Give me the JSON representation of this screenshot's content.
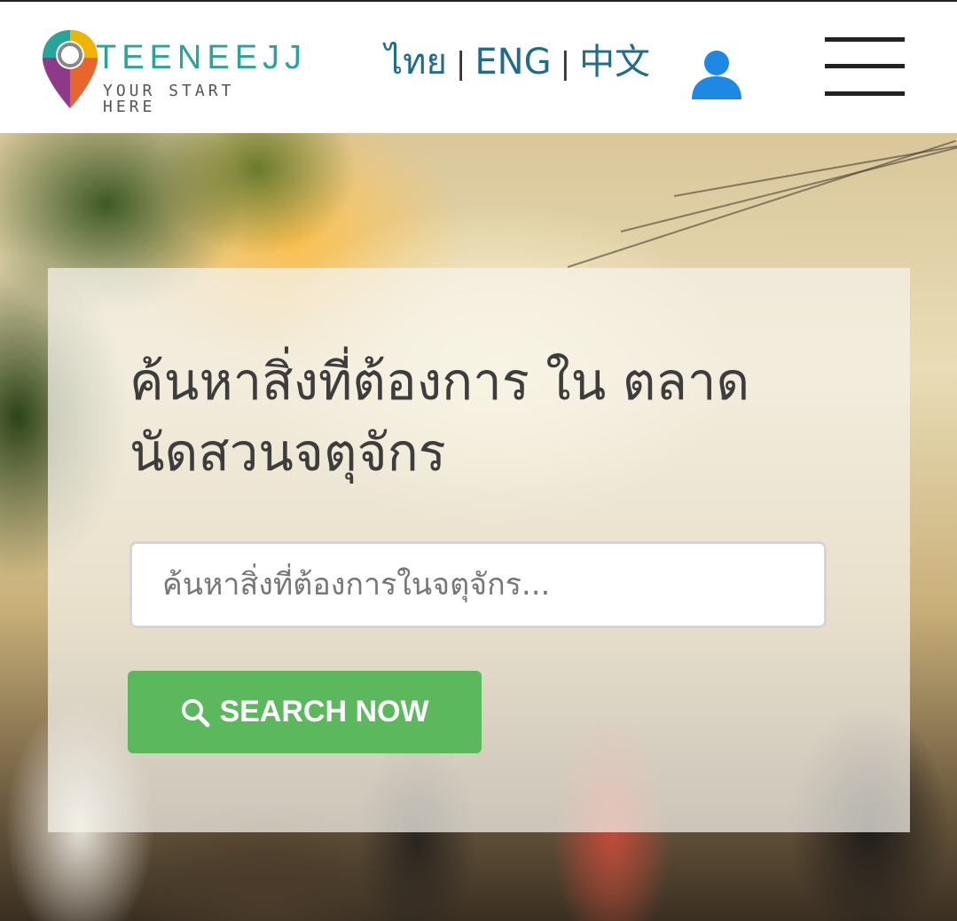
{
  "header": {
    "logo": {
      "name": "TEENEEJJ",
      "tagline": "YOUR START HERE"
    },
    "languages": [
      {
        "label": "ไทย"
      },
      {
        "label": "ENG"
      },
      {
        "label": "中文"
      }
    ],
    "separator": "|",
    "icons": {
      "account": "user-icon",
      "menu": "hamburger-menu-icon",
      "logo": "map-pin-icon"
    }
  },
  "hero": {
    "headline": "ค้นหาสิ่งที่ต้องการ ใน ตลาดนัดสวนจตุจักร",
    "search": {
      "placeholder": "ค้นหาสิ่งที่ต้องการในจตุจักร...",
      "value": ""
    },
    "button": {
      "label": "SEARCH NOW",
      "icon": "search-icon"
    }
  },
  "colors": {
    "logo_text": "#26a69a",
    "language_links": "#1f6d8a",
    "user_icon": "#1e88e5",
    "button": "#5cb85c"
  }
}
